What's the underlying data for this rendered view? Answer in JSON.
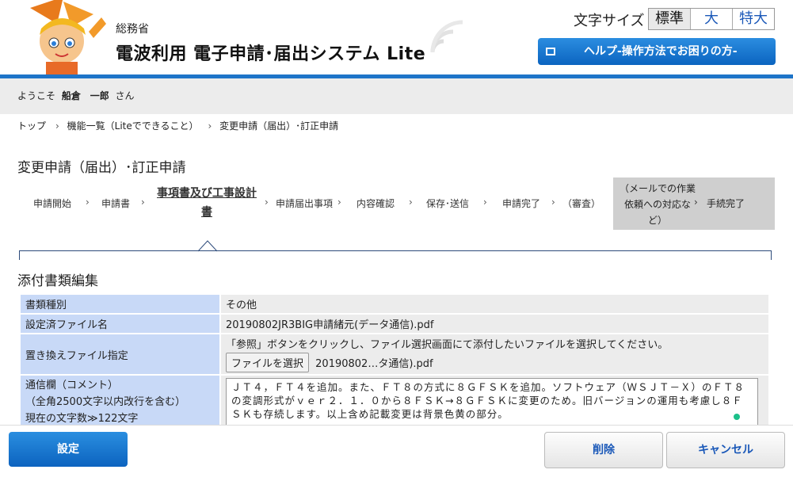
{
  "header": {
    "ministry": "総務省",
    "title": "電波利用 電子申請･届出システム Lite",
    "font_size_label": "文字サイズ",
    "font_sizes": [
      "標準",
      "大",
      "特大"
    ],
    "help_button": "ヘルプ-操作方法でお困りの方-"
  },
  "welcome": {
    "prefix": "ようこそ",
    "last_name": "船倉",
    "first_name": "一郎",
    "suffix": "さん"
  },
  "breadcrumb": [
    "トップ",
    "機能一覧（Liteでできること）",
    "変更申請（届出）･訂正申請"
  ],
  "page_title": "変更申請（届出）･訂正申請",
  "steps": {
    "s1": "申請開始",
    "s2": "申請書",
    "s3a": "事項書及び工事設計",
    "s3b": "書",
    "s4": "申請届出事項",
    "s5": "内容確認",
    "s6": "保存･送信",
    "s7": "申請完了",
    "s8": "（審査）",
    "s9a": "（メールでの作業",
    "s9b": "依頼への対応な",
    "s9c": "ど）",
    "s10": "手続完了"
  },
  "section_title": "添付書類編集",
  "form": {
    "row1_label": "書類種別",
    "row1_value": "その他",
    "row2_label": "設定済ファイル名",
    "row2_value": "20190802JR3BIG申請緒元(データ通信).pdf",
    "row3_label": "置き換えファイル指定",
    "row3_note": "「参照」ボタンをクリックし、ファイル選択画面にて添付したいファイルを選択してください。",
    "row3_button": "ファイルを選択",
    "row3_file": "20190802…タ通信).pdf",
    "row4_label1": "通信欄（コメント）",
    "row4_label2": "（全角2500文字以内改行を含む）",
    "row4_label3": "現在の文字数≫122文字",
    "row4_comment": "ＪＴ４，ＦＴ４を追加。また、ＦＴ８の方式に８ＧＦＳＫを追加。ソフトウェア（ＷＳＪＴ－Ｘ）のＦＴ８の変調形式がｖｅｒ２．１．０から８ＦＳＫ→８ＧＦＳＫに変更のため。旧バージョンの運用も考慮し８ＦＳＫも存続します。以上含め記載変更は背景色黄の部分。"
  },
  "buttons": {
    "set": "設定",
    "delete": "削除",
    "cancel": "キャンセル"
  },
  "colors": {
    "accent": "#1e74c8",
    "label_bg": "#c8d9f7",
    "value_bg": "#ececec"
  }
}
